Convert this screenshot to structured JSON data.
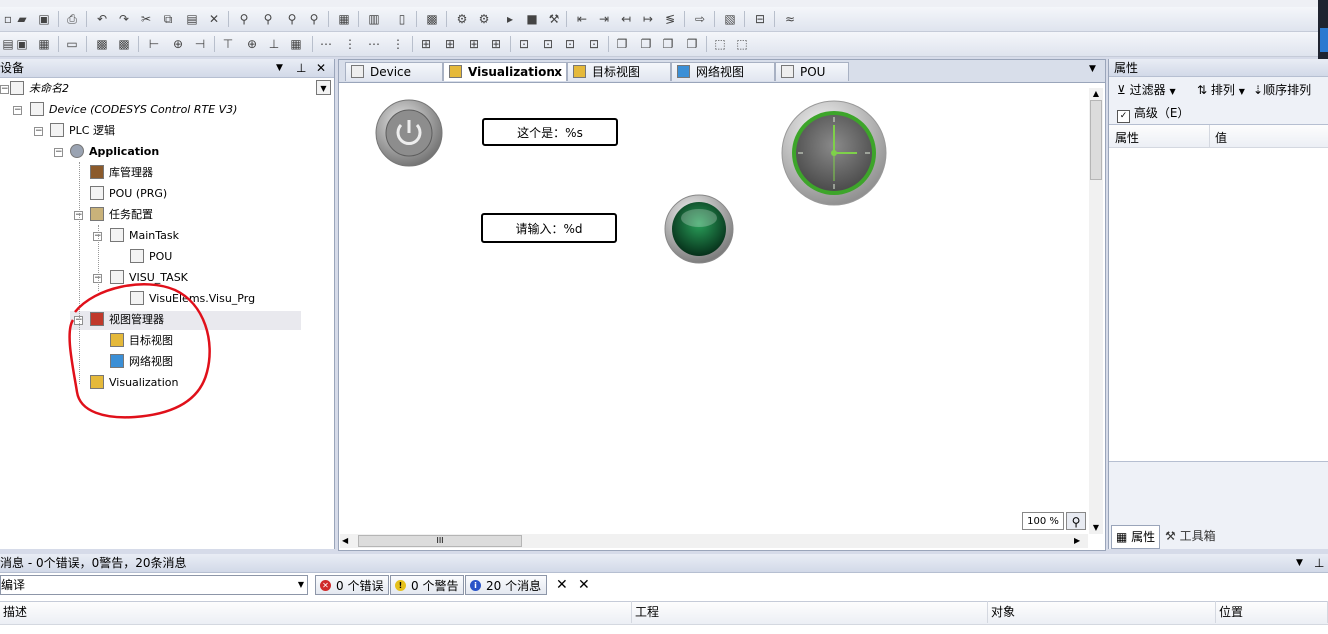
{
  "devices_panel": {
    "title": "设备",
    "pin": "⊥",
    "close": "✕",
    "tree": [
      {
        "label": "未命名2",
        "italic": true,
        "level": 0
      },
      {
        "label": "Device (CODESYS Control RTE V3)",
        "italic": true,
        "level": 1
      },
      {
        "label": "PLC 逻辑",
        "level": 2
      },
      {
        "label": "Application",
        "bold": true,
        "level": 3
      },
      {
        "label": "库管理器",
        "level": 4
      },
      {
        "label": "POU (PRG)",
        "level": 4
      },
      {
        "label": "任务配置",
        "level": 4
      },
      {
        "label": "MainTask",
        "level": 5
      },
      {
        "label": "POU",
        "level": 6
      },
      {
        "label": "VISU_TASK",
        "level": 5
      },
      {
        "label": "VisuElems.Visu_Prg",
        "level": 6
      },
      {
        "label": "视图管理器",
        "level": 4
      },
      {
        "label": "目标视图",
        "level": 5
      },
      {
        "label": "网络视图",
        "level": 5
      },
      {
        "label": "Visualization",
        "level": 4
      }
    ]
  },
  "editor": {
    "tabs": [
      "Device",
      "Visualization",
      "目标视图",
      "网络视图",
      "POU"
    ],
    "active_tab": "Visualization",
    "close_glyph": "x",
    "text_field_1": "这个是：%s",
    "text_field_2": "请输入：%d",
    "zoom": "100 %",
    "hscroll_grip": "III"
  },
  "properties_panel": {
    "title": "属性",
    "filter_label": "过滤器",
    "sort_label": "排列",
    "order_label": "顺序排列",
    "advanced_label": "高级（E）",
    "col_property": "属性",
    "col_value": "值",
    "tab_properties": "属性",
    "tab_toolbox": "工具箱"
  },
  "messages_panel": {
    "title": "消息 - 0个错误，0警告，20条消息",
    "category": "编译",
    "errors": "0 个错误",
    "warnings": "0 个警告",
    "messages": "20 个消息",
    "columns": [
      "描述",
      "工程",
      "对象",
      "位置"
    ]
  },
  "colors": {
    "annotation": "#e0101a",
    "clock_ring": "#3da52a",
    "lamp": "#0f5a2a"
  }
}
